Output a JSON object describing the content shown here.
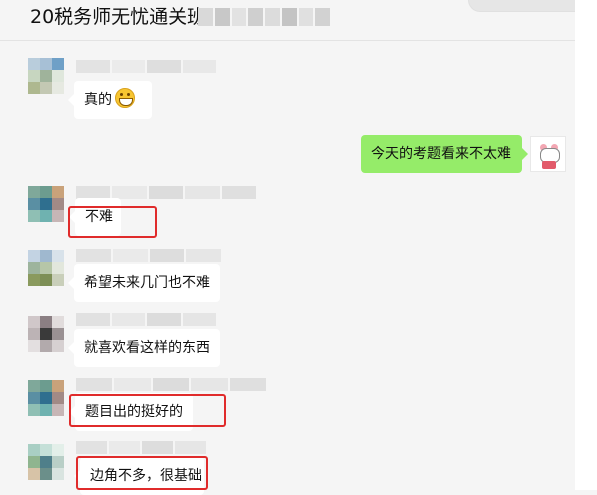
{
  "header": {
    "title": "20税务师无忧通关班"
  },
  "messages": [
    {
      "from": "other",
      "text": "真的",
      "emoji": "grinning-face"
    },
    {
      "from": "me",
      "text": "今天的考题看来不太难"
    },
    {
      "from": "other",
      "text": "不难",
      "highlighted": true
    },
    {
      "from": "other",
      "text": "希望未来几门也不难"
    },
    {
      "from": "other",
      "text": "就喜欢看这样的东西"
    },
    {
      "from": "other",
      "text": "题目出的挺好的",
      "highlighted": true
    },
    {
      "from": "other",
      "text": "边角不多，很基础",
      "highlighted": true
    }
  ],
  "colors": {
    "background": "#f5f5f5",
    "bubble_other": "#ffffff",
    "bubble_me": "#95ec69",
    "highlight": "#e02b2b"
  }
}
